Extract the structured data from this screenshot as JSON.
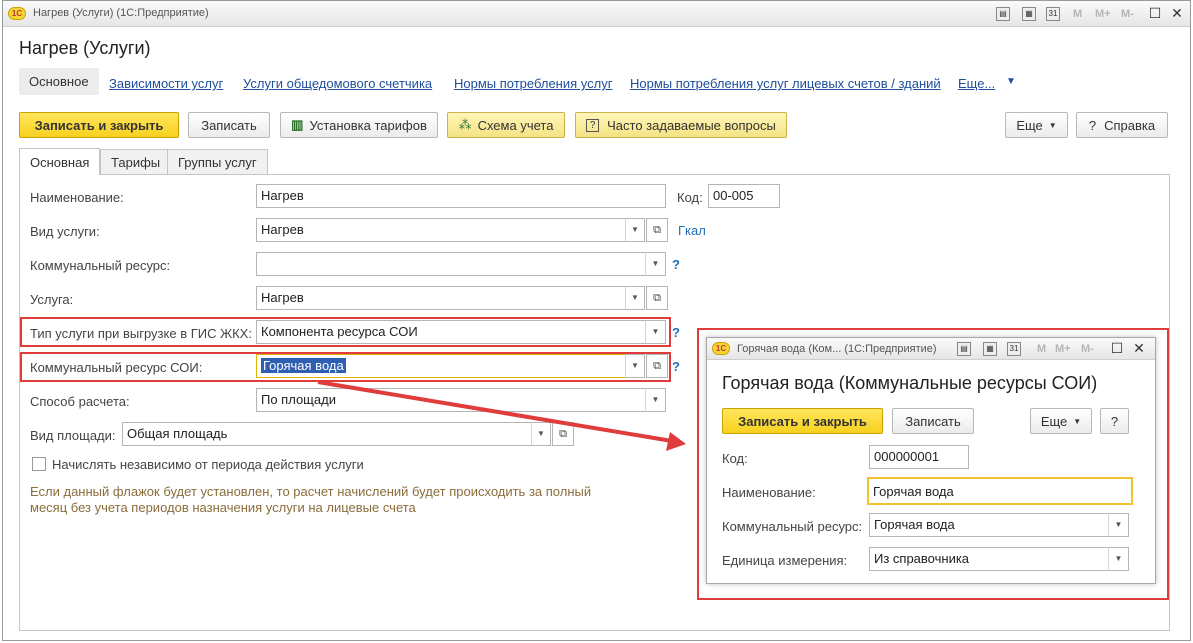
{
  "window": {
    "title": "Нагрев (Услуги)  (1С:Предприятие)",
    "logo": "1С",
    "icons": [
      "print-icon",
      "calc-icon",
      "calendar-icon"
    ],
    "mem": [
      "M",
      "M+",
      "M-"
    ]
  },
  "page_title": "Нагрев (Услуги)",
  "nav": {
    "current": "Основное",
    "links": [
      "Зависимости услуг",
      "Услуги общедомового счетчика",
      "Нормы потребления услуг",
      "Нормы потребления услуг лицевых счетов / зданий"
    ],
    "more": "Еще..."
  },
  "toolbar": {
    "save_close": "Записать и закрыть",
    "save": "Записать",
    "tariffs": "Установка тарифов",
    "scheme": "Схема учета",
    "faq": "Часто задаваемые вопросы",
    "more": "Еще",
    "help": "Справка"
  },
  "tabs": [
    "Основная",
    "Тарифы",
    "Группы услуг"
  ],
  "form": {
    "name_label": "Наименование:",
    "name_value": "Нагрев",
    "code_label": "Код:",
    "code_value": "00-005",
    "service_type_label": "Вид услуги:",
    "service_type_value": "Нагрев",
    "service_type_link": "Гкал",
    "resource_label": "Коммунальный ресурс:",
    "resource_value": "",
    "service_label": "Услуга:",
    "service_value": "Нагрев",
    "gis_label": "Тип услуги при выгрузке в ГИС ЖКХ:",
    "gis_value": "Компонента ресурса СОИ",
    "soi_label": "Коммунальный ресурс СОИ:",
    "soi_value": "Горячая вода",
    "calc_label": "Способ расчета:",
    "calc_value": "По площади",
    "area_label": "Вид площади:",
    "area_value": "Общая площадь",
    "checkbox_label": "Начислять независимо от периода действия услуги",
    "checkbox_checked": false,
    "hint_line1": "Если данный флажок будет установлен, то расчет начислений будет происходить за полный",
    "hint_line2": "месяц без учета периодов назначения услуги на лицевые счета",
    "help_mark": "?"
  },
  "popup": {
    "title": "Горячая вода (Ком...  (1С:Предприятие)",
    "heading": "Горячая вода (Коммунальные ресурсы СОИ)",
    "save_close": "Записать и закрыть",
    "save": "Записать",
    "more": "Еще",
    "help": "?",
    "code_label": "Код:",
    "code_value": "000000001",
    "name_label": "Наименование:",
    "name_value": "Горячая вода",
    "resource_label": "Коммунальный ресурс:",
    "resource_value": "Горячая вода",
    "unit_label": "Единица измерения:",
    "unit_value": "Из справочника"
  },
  "colors": {
    "accent_yellow": "#f7d11e",
    "highlight_red": "#e03c3c",
    "link_blue": "#1f4e9c",
    "selection": "#2f5fb3"
  }
}
